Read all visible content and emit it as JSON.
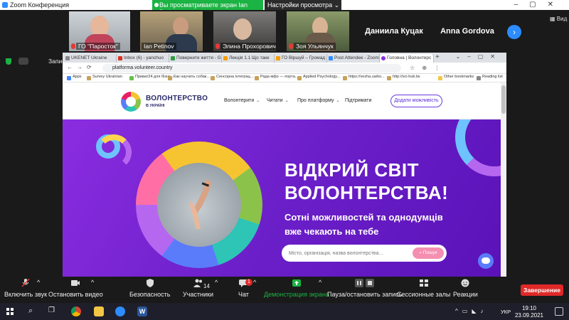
{
  "zoom": {
    "window_title": "Zoom Конференция",
    "share_banner": "Вы просматриваете экран Ian Petinov",
    "view_options": "Настройки просмотра",
    "view_button": "Вид",
    "recording_label": "Запись",
    "participants": [
      {
        "name": "ГО \"Паросток\""
      },
      {
        "name": "Ian Petinov"
      },
      {
        "name": "Элина Прохорович"
      },
      {
        "name": "Зоя Ульянчук"
      },
      {
        "name": "Даниила Куцак"
      },
      {
        "name": "Anna Gordova"
      }
    ]
  },
  "browser": {
    "tabs": [
      "UKENET Ukraine",
      "Inbox (6) - yanchuo",
      "Поверните життя - G",
      "Лекція 1.1 Що таке",
      "ГО Віршуй – Громад",
      "Post Attendee - Zoom",
      "Головна | Волонтерс"
    ],
    "url": "platforma.volunteer.country",
    "bookmarks": [
      "Apps",
      "Survey Ukrainian",
      "Приват24 для бізне...",
      "Как научить собак...",
      "Сенсорна інтеграц...",
      "Рада мфо — порта...",
      "Applied Psychology...",
      "https://vezha.ua/ko...",
      "http://sci-hub.tw",
      "Other bookmarks",
      "Reading list"
    ]
  },
  "site": {
    "logo_title": "ВОЛОНТЕРСТВО",
    "logo_sub": "В УКРАЇНІ",
    "nav": [
      {
        "label": "Волонтерити",
        "has_chevron": true
      },
      {
        "label": "Читати",
        "has_chevron": true
      },
      {
        "label": "Про платформу",
        "has_chevron": true
      },
      {
        "label": "Підтримати",
        "has_chevron": false
      }
    ],
    "add_button": "Додати можливість",
    "hero_title_line1": "ВІДКРИЙ СВІТ",
    "hero_title_line2": "ВОЛОНТЕРСТВА!",
    "hero_sub_line1": "Сотні можливостей та однодумців",
    "hero_sub_line2": "вже чекають на тебе",
    "search_placeholder": "Місто, організація, назва волонтерства...",
    "search_button": "Пошук",
    "colors": {
      "hero_purple": "#7a22d6",
      "accent_pink": "#f48fb1",
      "brand_navy": "#2b2b6b"
    }
  },
  "toolbar": {
    "unmute": "Включить звук",
    "stop_video": "Остановить видео",
    "security": "Безопасность",
    "participants": "Участники",
    "participants_count": "14",
    "chat": "Чат",
    "chat_badge": "1",
    "share_screen": "Демонстрация экрана",
    "record": "Пауза/остановить запись",
    "breakout": "Сессионные залы",
    "reactions": "Реакции",
    "end": "Завершение"
  },
  "taskbar": {
    "language": "УКР",
    "time": "19:10",
    "date": "23.09.2021"
  }
}
